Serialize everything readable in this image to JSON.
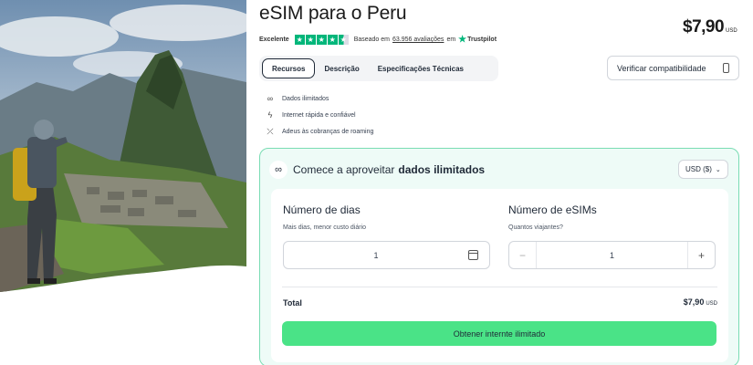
{
  "hero": {
    "alt": "Machu Picchu"
  },
  "product": {
    "title": "eSIM para o Peru",
    "price": "$7,90",
    "currency_code": "USD"
  },
  "rating": {
    "label": "Excelente",
    "stars": 4.5,
    "based_on": "Baseado em",
    "count": "63.956 avaliações",
    "on": "em",
    "provider": "Trustpilot",
    "accent": "#00b67a"
  },
  "tabs": [
    {
      "label": "Recursos",
      "active": true
    },
    {
      "label": "Descrição",
      "active": false
    },
    {
      "label": "Especificações Técnicas",
      "active": false
    }
  ],
  "verify_button": {
    "label": "Verificar compatibilidade",
    "icon": "phone-icon"
  },
  "features": [
    {
      "icon": "infinity-icon",
      "label": "Dados ilimitados"
    },
    {
      "icon": "bolt-icon",
      "label": "Internet rápida e confiável"
    },
    {
      "icon": "no-roaming-icon",
      "label": "Adeus às cobranças de roaming"
    }
  ],
  "card": {
    "heading_prefix": "Comece a aproveitar",
    "heading_bold": "dados ilimitados",
    "currency_select": "USD ($)",
    "accent": "#79dcb3",
    "days": {
      "label": "Número de dias",
      "hint": "Mais dias, menor custo diário",
      "value": "1"
    },
    "esims": {
      "label": "Número de eSIMs",
      "hint": "Quantos viajantes?",
      "value": "1",
      "minus": "−",
      "plus": "+"
    },
    "total_label": "Total",
    "total_value": "$7,90",
    "total_currency": "USD",
    "cta": "Obtener internte ilimitado",
    "cta_color": "#4ae387"
  }
}
